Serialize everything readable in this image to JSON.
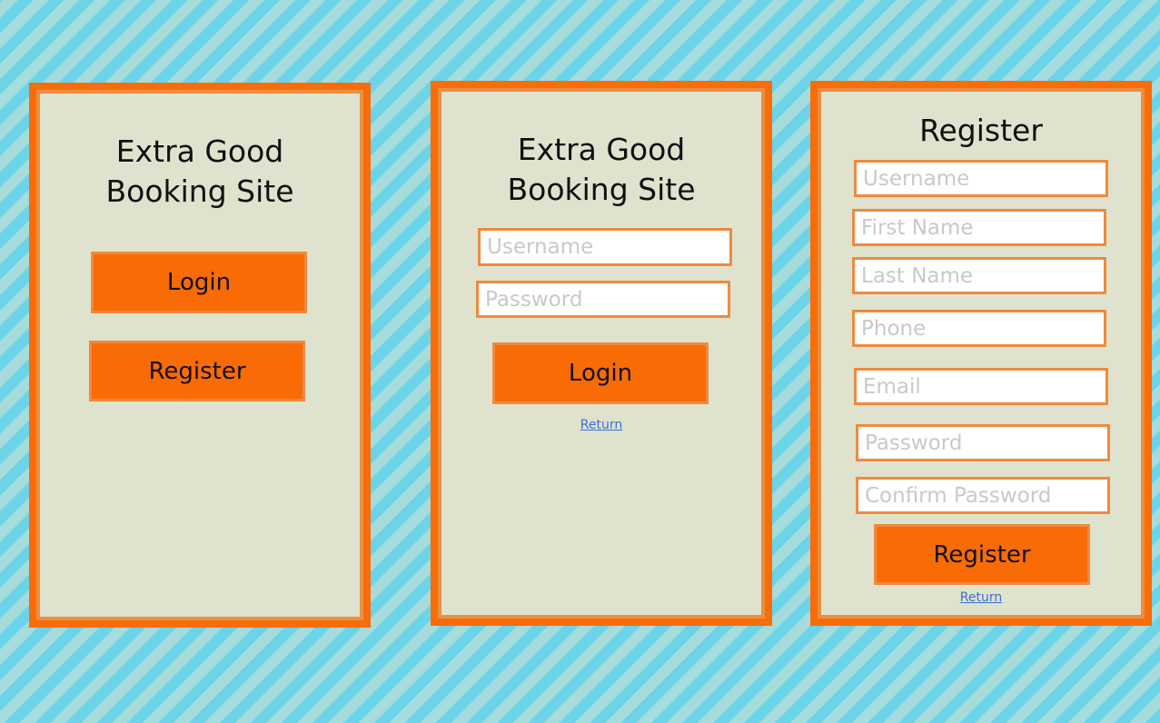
{
  "home": {
    "title_line1": "Extra Good",
    "title_line2": "Booking Site",
    "login_label": "Login",
    "register_label": "Register"
  },
  "login": {
    "title_line1": "Extra Good",
    "title_line2": "Booking Site",
    "username_placeholder": "Username",
    "password_placeholder": "Password",
    "login_label": "Login",
    "return_label": "Return"
  },
  "register": {
    "title": "Register",
    "fields": {
      "username": "Username",
      "first_name": "First Name",
      "last_name": "Last Name",
      "phone": "Phone",
      "email": "Email",
      "password": "Password",
      "confirm_password": "Confirm Password"
    },
    "register_label": "Register",
    "return_label": "Return"
  },
  "colors": {
    "panel_border": "#f86c0a",
    "panel_inner_border": "#eb8f44",
    "panel_fill": "#dfe3cd",
    "button_fill": "#f96b05",
    "button_border": "#ef8a40",
    "background_stripe_a": "#6cd4e8",
    "background_stripe_b": "#a6dcdb",
    "link": "#3a6fd4"
  }
}
